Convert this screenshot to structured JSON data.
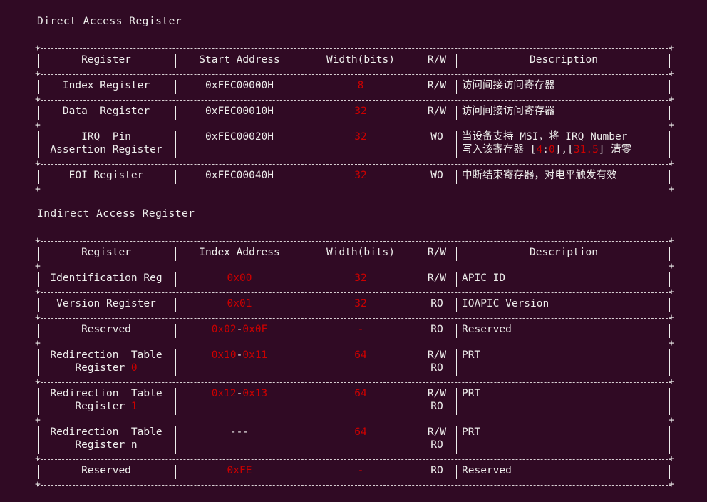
{
  "direct": {
    "title": "Direct Access Register",
    "headers": [
      "Register",
      "Start Address",
      "Width(bits)",
      "R/W",
      "Description"
    ],
    "rows": [
      {
        "register": [
          "Index Register"
        ],
        "address": [
          [
            {
              "t": "0xFEC00000H"
            }
          ]
        ],
        "width": "8",
        "rw": [
          "R/W"
        ],
        "desc": [
          [
            {
              "t": "访问间接访问寄存器"
            }
          ]
        ]
      },
      {
        "register": [
          "Data  Register"
        ],
        "address": [
          [
            {
              "t": "0xFEC00010H"
            }
          ]
        ],
        "width": "32",
        "rw": [
          "R/W"
        ],
        "desc": [
          [
            {
              "t": "访问间接访问寄存器"
            }
          ]
        ]
      },
      {
        "register": [
          "IRQ  Pin",
          "Assertion Register"
        ],
        "address": [
          [
            {
              "t": "0xFEC00020H"
            }
          ]
        ],
        "width": "32",
        "rw": [
          "WO"
        ],
        "desc": [
          [
            {
              "t": "当设备支持 MSI，将 IRQ Number"
            }
          ],
          [
            {
              "t": "写入该寄存器 ["
            },
            {
              "t": "4",
              "r": 1
            },
            {
              "t": ":"
            },
            {
              "t": "0",
              "r": 1
            },
            {
              "t": "],["
            },
            {
              "t": "31.5",
              "r": 1
            },
            {
              "t": "] 清零"
            }
          ]
        ]
      },
      {
        "register": [
          "EOI Register"
        ],
        "address": [
          [
            {
              "t": "0xFEC00040H"
            }
          ]
        ],
        "width": "32",
        "rw": [
          "WO"
        ],
        "desc": [
          [
            {
              "t": "中断结束寄存器，对电平触发有效"
            }
          ]
        ]
      }
    ]
  },
  "indirect": {
    "title": "Indirect Access Register",
    "headers": [
      "Register",
      "Index Address",
      "Width(bits)",
      "R/W",
      "Description"
    ],
    "rows": [
      {
        "register": [
          "Identification Reg"
        ],
        "address": [
          [
            {
              "t": "0x00",
              "r": 1
            }
          ]
        ],
        "width": "32",
        "rw": [
          "R/W"
        ],
        "desc": [
          [
            {
              "t": "APIC ID"
            }
          ]
        ]
      },
      {
        "register": [
          "Version Register"
        ],
        "address": [
          [
            {
              "t": "0x01",
              "r": 1
            }
          ]
        ],
        "width": "32",
        "rw": [
          "RO"
        ],
        "desc": [
          [
            {
              "t": "IOAPIC Version"
            }
          ]
        ]
      },
      {
        "register": [
          "Reserved"
        ],
        "address": [
          [
            {
              "t": "0x02",
              "r": 1
            },
            {
              "t": "-"
            },
            {
              "t": "0x0F",
              "r": 1
            }
          ]
        ],
        "width": "-",
        "rw": [
          "RO"
        ],
        "desc": [
          [
            {
              "t": "Reserved"
            }
          ]
        ]
      },
      {
        "register": [
          [
            {
              "t": "Redirection  Table"
            }
          ],
          [
            {
              "t": "Register "
            },
            {
              "t": "0",
              "r": 1
            }
          ]
        ],
        "address": [
          [
            {
              "t": "0x10",
              "r": 1
            },
            {
              "t": "-"
            },
            {
              "t": "0x11",
              "r": 1
            }
          ]
        ],
        "width": "64",
        "rw": [
          "R/W",
          "RO"
        ],
        "desc": [
          [
            {
              "t": "PRT"
            }
          ]
        ]
      },
      {
        "register": [
          [
            {
              "t": "Redirection  Table"
            }
          ],
          [
            {
              "t": "Register "
            },
            {
              "t": "1",
              "r": 1
            }
          ]
        ],
        "address": [
          [
            {
              "t": "0x12",
              "r": 1
            },
            {
              "t": "-"
            },
            {
              "t": "0x13",
              "r": 1
            }
          ]
        ],
        "width": "64",
        "rw": [
          "R/W",
          "RO"
        ],
        "desc": [
          [
            {
              "t": "PRT"
            }
          ]
        ]
      },
      {
        "register": [
          "Redirection  Table",
          "Register n"
        ],
        "address": [
          [
            {
              "t": "---"
            }
          ]
        ],
        "width": "64",
        "rw": [
          "R/W",
          "RO"
        ],
        "desc": [
          [
            {
              "t": "PRT"
            }
          ]
        ]
      },
      {
        "register": [
          "Reserved"
        ],
        "address": [
          [
            {
              "t": "0xFE",
              "r": 1
            }
          ]
        ],
        "width": "-",
        "rw": [
          "RO"
        ],
        "desc": [
          [
            {
              "t": "Reserved"
            }
          ]
        ]
      }
    ]
  },
  "colors": {
    "background": "#300a24",
    "text": "#eeeeec",
    "highlight": "#cc0000"
  }
}
